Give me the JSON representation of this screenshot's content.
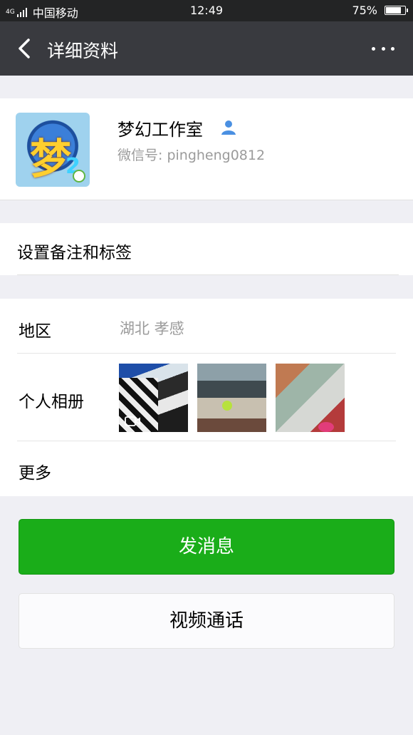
{
  "status_bar": {
    "network": "4G",
    "carrier": "中国移动",
    "time": "12:49",
    "battery": "75%",
    "battery_level": 0.75
  },
  "nav": {
    "title": "详细资料",
    "back_icon": "chevron-left-icon",
    "more_icon": "more-dots-icon"
  },
  "profile": {
    "name": "梦幻工作室",
    "wechat_id": "微信号: pingheng0812",
    "avatar_glyph": "梦",
    "avatar_glyph_number": "2"
  },
  "remark": {
    "label": "设置备注和标签"
  },
  "info": {
    "region_label": "地区",
    "region_value": "湖北  孝感",
    "album_label": "个人相册",
    "more_label": "更多"
  },
  "actions": {
    "send_message": "发消息",
    "video_call": "视频通话"
  },
  "colors": {
    "nav_bg": "#393a3f",
    "status_bg": "#232425",
    "primary_green": "#1aad19",
    "page_bg": "#efeff4",
    "verified_blue": "#4a90e2"
  }
}
